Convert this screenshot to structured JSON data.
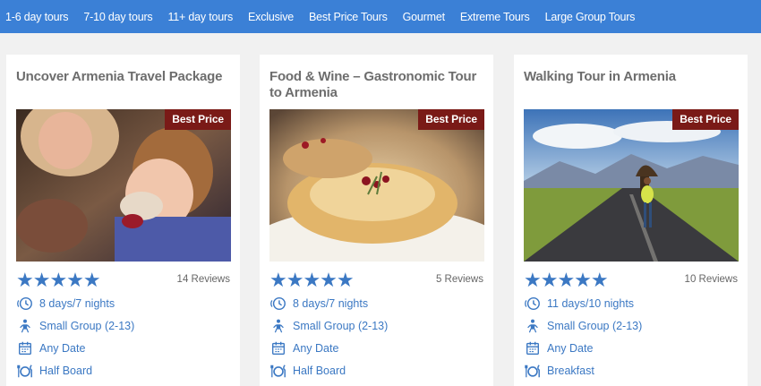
{
  "nav": {
    "items": [
      "1-6 day tours",
      "7-10 day tours",
      "11+ day tours",
      "Exclusive",
      "Best Price Tours",
      "Gourmet",
      "Extreme Tours",
      "Large Group Tours"
    ]
  },
  "colors": {
    "nav_bg": "#3b80d6",
    "badge_bg": "#7a1a17",
    "accent": "#3b78c3"
  },
  "tours": [
    {
      "title": "Uncover Armenia Travel Package",
      "badge": "Best Price",
      "stars": "★★★★★",
      "reviews": "14 Reviews",
      "duration": "8 days/7 nights",
      "group": "Small Group (2-13)",
      "date": "Any Date",
      "meals": "Half Board"
    },
    {
      "title": "Food & Wine – Gastronomic Tour to Armenia",
      "badge": "Best Price",
      "stars": "★★★★★",
      "reviews": "5 Reviews",
      "duration": "8 days/7 nights",
      "group": "Small Group (2-13)",
      "date": "Any Date",
      "meals": "Half Board"
    },
    {
      "title": "Walking Tour in Armenia",
      "badge": "Best Price",
      "stars": "★★★★★",
      "reviews": "10 Reviews",
      "duration": "11 days/10 nights",
      "group": "Small Group (2-13)",
      "date": "Any Date",
      "meals": "Breakfast"
    }
  ]
}
